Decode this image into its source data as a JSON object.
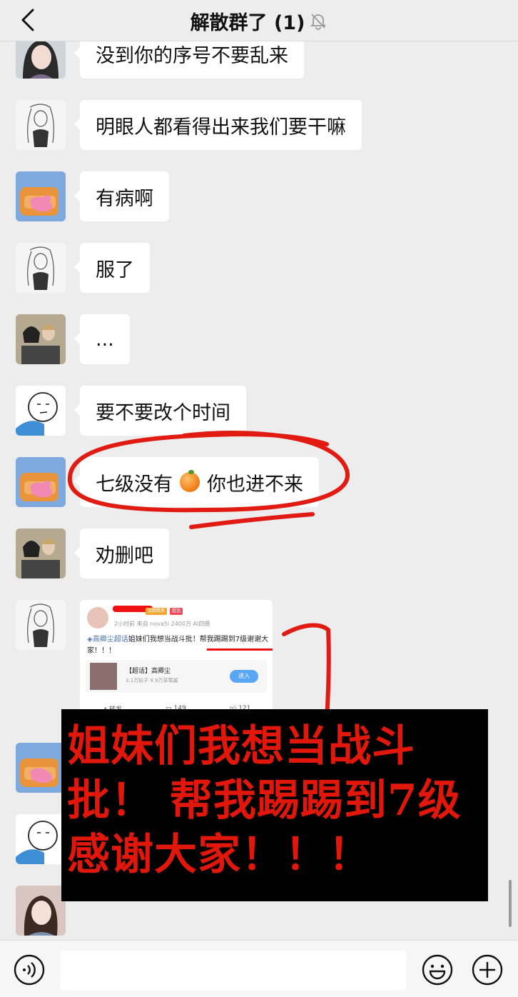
{
  "header": {
    "title": "解散群了 (1)",
    "back_icon": "chevron-left-icon",
    "mute_icon": "bell-off-icon"
  },
  "messages": [
    {
      "avatar": "avatar-girl-photo",
      "text": "没到你的序号不要乱来"
    },
    {
      "avatar": "avatar-sketch-woman",
      "text": "明眼人都看得出来我们要干嘛"
    },
    {
      "avatar": "avatar-sofa-cartoon",
      "text": "有病啊"
    },
    {
      "avatar": "avatar-sketch-woman",
      "text": "服了"
    },
    {
      "avatar": "avatar-two-people-photo",
      "text": "..."
    },
    {
      "avatar": "avatar-face-cartoon",
      "text": "要不要改个时间"
    },
    {
      "avatar": "avatar-sofa-cartoon",
      "text_before": "七级没有",
      "emoji": "orange-emoji",
      "text_after": "你也进不来"
    },
    {
      "avatar": "avatar-two-people-photo",
      "text": "劝删吧"
    }
  ],
  "shared_card": {
    "meta": "2小时前  来自 nova5i 2400万 AI四摄",
    "badge1": "话题精英",
    "badge2": "超话",
    "tag": "◈高卿尘超话",
    "text": "姐妹们我想当战斗批！帮我踢踢到7级谢谢大家！！！",
    "topic_title": "【超话】高卿尘",
    "topic_sub": "3.1万帖子  9.9万草莓酱",
    "enter_label": "进入",
    "forward_label": "转发",
    "comments_count": "149",
    "likes_count": "121"
  },
  "overlay_caption": {
    "line1": "姐妹们我想当战斗",
    "line2": "批！ 帮我踢踢到7级",
    "line3": "感谢大家！！！"
  },
  "annotation_colors": {
    "red": "#e11a12"
  },
  "input_bar": {
    "voice_icon": "voice-icon",
    "emoji_icon": "emoji-icon",
    "plus_icon": "plus-icon",
    "input_value": ""
  }
}
